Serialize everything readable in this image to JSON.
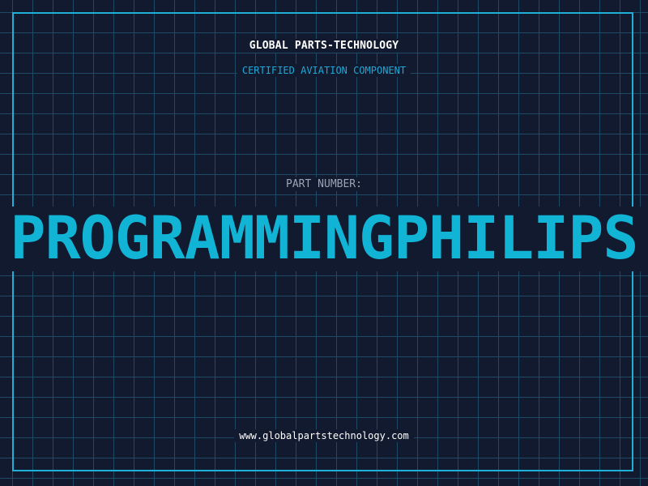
{
  "header": {
    "company": "GLOBAL PARTS-TECHNOLOGY",
    "subtitle": "CERTIFIED AVIATION COMPONENT"
  },
  "part": {
    "label": "PART NUMBER:",
    "value": "PROGRAMMINGPHILIPS"
  },
  "footer": {
    "url": "www.globalpartstechnology.com"
  },
  "colors": {
    "background": "#111a2e",
    "grid": "#1f4a66",
    "accent": "#12b4d6",
    "frame": "#1fb0d8"
  }
}
